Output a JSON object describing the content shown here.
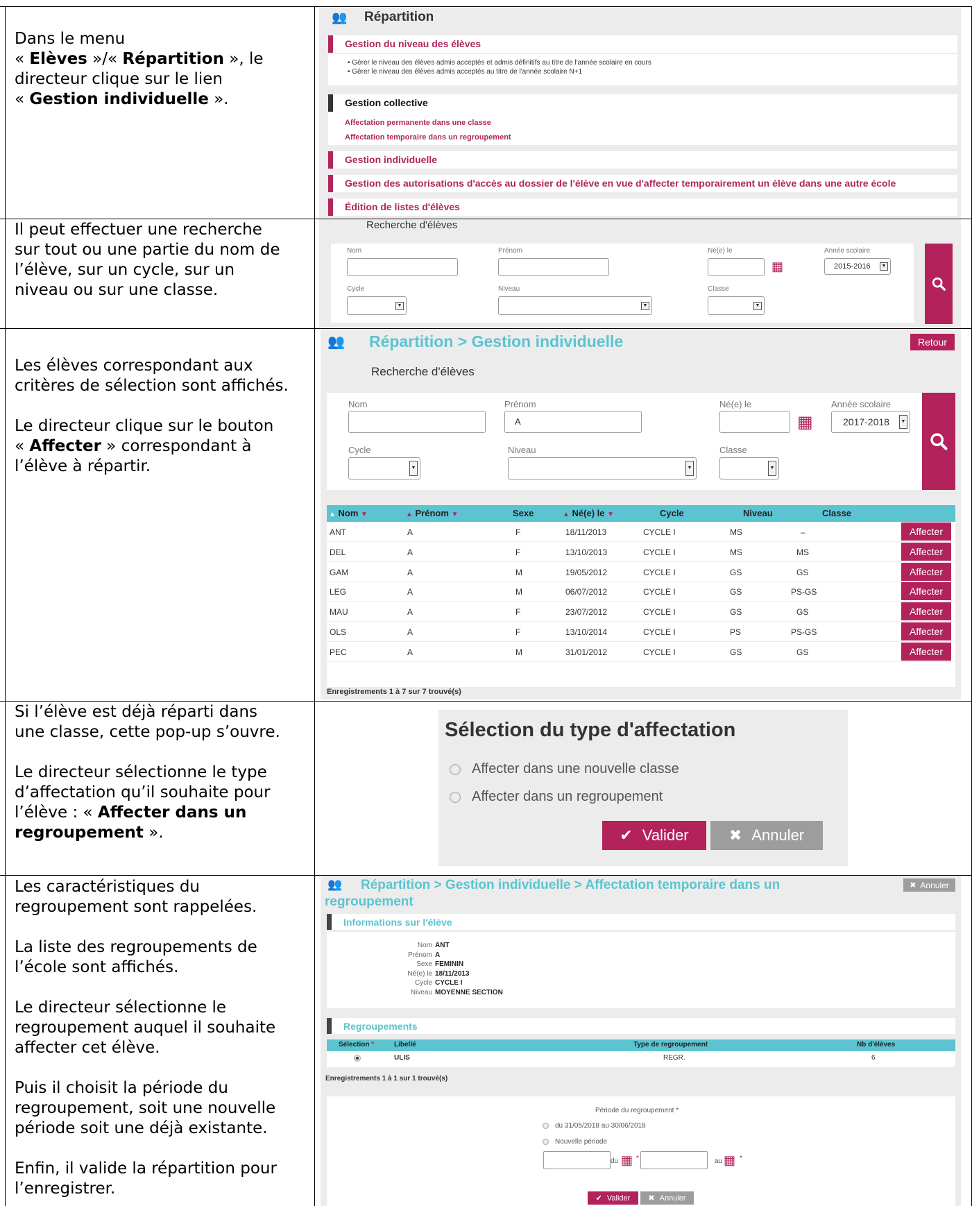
{
  "rows": [
    {
      "lines": [
        "Dans le menu",
        "« <b>Elèves</b> »/« <b>Répartition</b> », le",
        "directeur clique sur le lien",
        "« <b>Gestion individuelle</b> »."
      ]
    },
    {
      "lines": [
        "Il peut effectuer une recherche",
        "sur tout ou une partie du nom de",
        "l’élève, sur un cycle, sur un",
        "niveau ou sur une classe."
      ]
    },
    {
      "lines": [
        "Les élèves correspondant aux",
        "critères de sélection sont affichés.",
        "",
        "Le directeur clique sur le bouton",
        "« <b>Affecter</b> » correspondant à",
        "l’élève à répartir."
      ]
    },
    {
      "lines": [
        "Si l’élève est déjà réparti dans",
        "une classe, cette pop-up s’ouvre.",
        "",
        "Le directeur sélectionne le type",
        "d’affectation qu’il souhaite pour",
        "l’élève : « <b>Affecter dans un</b>",
        "<b>regroupement</b> »."
      ]
    },
    {
      "lines": [
        "Les caractéristiques du",
        "regroupement sont rappelées.",
        "",
        "La liste des regroupements de",
        "l’école sont affichés.",
        "",
        "Le directeur sélectionne le",
        "regroupement auquel il souhaite",
        "affecter cet élève.",
        "",
        "Puis il choisit la période du",
        "regroupement, soit une nouvelle",
        "période soit une déjà existante.",
        "",
        "Enfin, il valide la répartition pour",
        "l’enregistrer."
      ]
    }
  ],
  "s1": {
    "title": "Répartition",
    "niveau_title": "Gestion du niveau des élèves",
    "niveau_items": [
      "Gérer le niveau des élèves admis acceptés et admis définitifs au titre de l'année scolaire en cours",
      "Gérer le niveau des élèves admis acceptés au titre de l'année scolaire N+1"
    ],
    "collective_title": "Gestion collective",
    "collective_links": [
      "Affectation permanente dans une classe",
      "Affectation temporaire dans un regroupement"
    ],
    "individuelle": "Gestion individuelle",
    "autorisations": "Gestion des autorisations d'accès au dossier de l'élève en vue d'affecter temporairement un élève dans une autre école",
    "edition": "Édition de listes d'élèves"
  },
  "s2": {
    "title": "Recherche d'élèves",
    "nom": "Nom",
    "prenom": "Prénom",
    "ne": "Né(e) le",
    "annee": "Année scolaire",
    "annee_val": "2015-2016",
    "cycle": "Cycle",
    "niveau": "Niveau",
    "classe": "Classe"
  },
  "s3": {
    "title": "Répartition > Gestion individuelle",
    "retour": "Retour",
    "search_title": "Recherche d'élèves",
    "nom": "Nom",
    "prenom": "Prénom",
    "prenom_val": "A",
    "ne": "Né(e) le",
    "annee": "Année scolaire",
    "annee_val": "2017-2018",
    "cycle": "Cycle",
    "niveau": "Niveau",
    "classe": "Classe",
    "columns": [
      "Nom",
      "Prénom",
      "Sexe",
      "Né(e) le",
      "Cycle",
      "Niveau",
      "Classe"
    ],
    "students": [
      {
        "nom": "ANT",
        "prenom": "A",
        "sexe": "F",
        "ne": "18/11/2013",
        "cycle": "CYCLE I",
        "niveau": "MS",
        "classe": "–"
      },
      {
        "nom": "DEL",
        "prenom": "A",
        "sexe": "F",
        "ne": "13/10/2013",
        "cycle": "CYCLE I",
        "niveau": "MS",
        "classe": "MS"
      },
      {
        "nom": "GAM",
        "prenom": "A",
        "sexe": "M",
        "ne": "19/05/2012",
        "cycle": "CYCLE I",
        "niveau": "GS",
        "classe": "GS"
      },
      {
        "nom": "LEG",
        "prenom": "A",
        "sexe": "M",
        "ne": "06/07/2012",
        "cycle": "CYCLE I",
        "niveau": "GS",
        "classe": "PS-GS"
      },
      {
        "nom": "MAU",
        "prenom": "A",
        "sexe": "F",
        "ne": "23/07/2012",
        "cycle": "CYCLE I",
        "niveau": "GS",
        "classe": "GS"
      },
      {
        "nom": "OLS",
        "prenom": "A",
        "sexe": "F",
        "ne": "13/10/2014",
        "cycle": "CYCLE I",
        "niveau": "PS",
        "classe": "PS-GS"
      },
      {
        "nom": "PEC",
        "prenom": "A",
        "sexe": "M",
        "ne": "31/01/2012",
        "cycle": "CYCLE I",
        "niveau": "GS",
        "classe": "GS"
      }
    ],
    "affecter": "Affecter",
    "footer": "Enregistrements 1 à 7 sur 7 trouvé(s)"
  },
  "s4": {
    "title": "Sélection du type d'affectation",
    "option1": "Affecter dans une nouvelle classe",
    "option2": "Affecter dans un regroupement",
    "valider": "Valider",
    "annuler": "Annuler"
  },
  "s5": {
    "title_line1": "Répartition > Gestion individuelle > Affectation temporaire dans un",
    "title_line2": "regroupement",
    "annuler_top": "Annuler",
    "info_title": "Informations sur l'élève",
    "info": [
      {
        "k": "Nom",
        "v": "ANT"
      },
      {
        "k": "Prénom",
        "v": "A"
      },
      {
        "k": "Sexe",
        "v": "FEMININ"
      },
      {
        "k": "Né(e) le",
        "v": "18/11/2013"
      },
      {
        "k": "Cycle",
        "v": "CYCLE I"
      },
      {
        "k": "Niveau",
        "v": "MOYENNE SECTION"
      }
    ],
    "regroup_title": "Regroupements",
    "columns": {
      "selection": "Sélection",
      "libelle": "Libellé",
      "type": "Type de regroupement",
      "nb": "Nb d'élèves"
    },
    "regroup_row": {
      "libelle": "ULIS",
      "type": "REGR.",
      "nb": "6"
    },
    "footer": "Enregistrements 1 à 1 sur 1 trouvé(s)",
    "periode_label": "Période du regroupement",
    "periode1": "du 31/05/2018 au 30/06/2018",
    "periode2": "Nouvelle période",
    "du": "du",
    "au": "au",
    "valider": "Valider",
    "annuler": "Annuler"
  },
  "colors": {
    "magenta": "#b0265d",
    "teal": "#5bc4d0",
    "grey_panel": "#ececec"
  }
}
